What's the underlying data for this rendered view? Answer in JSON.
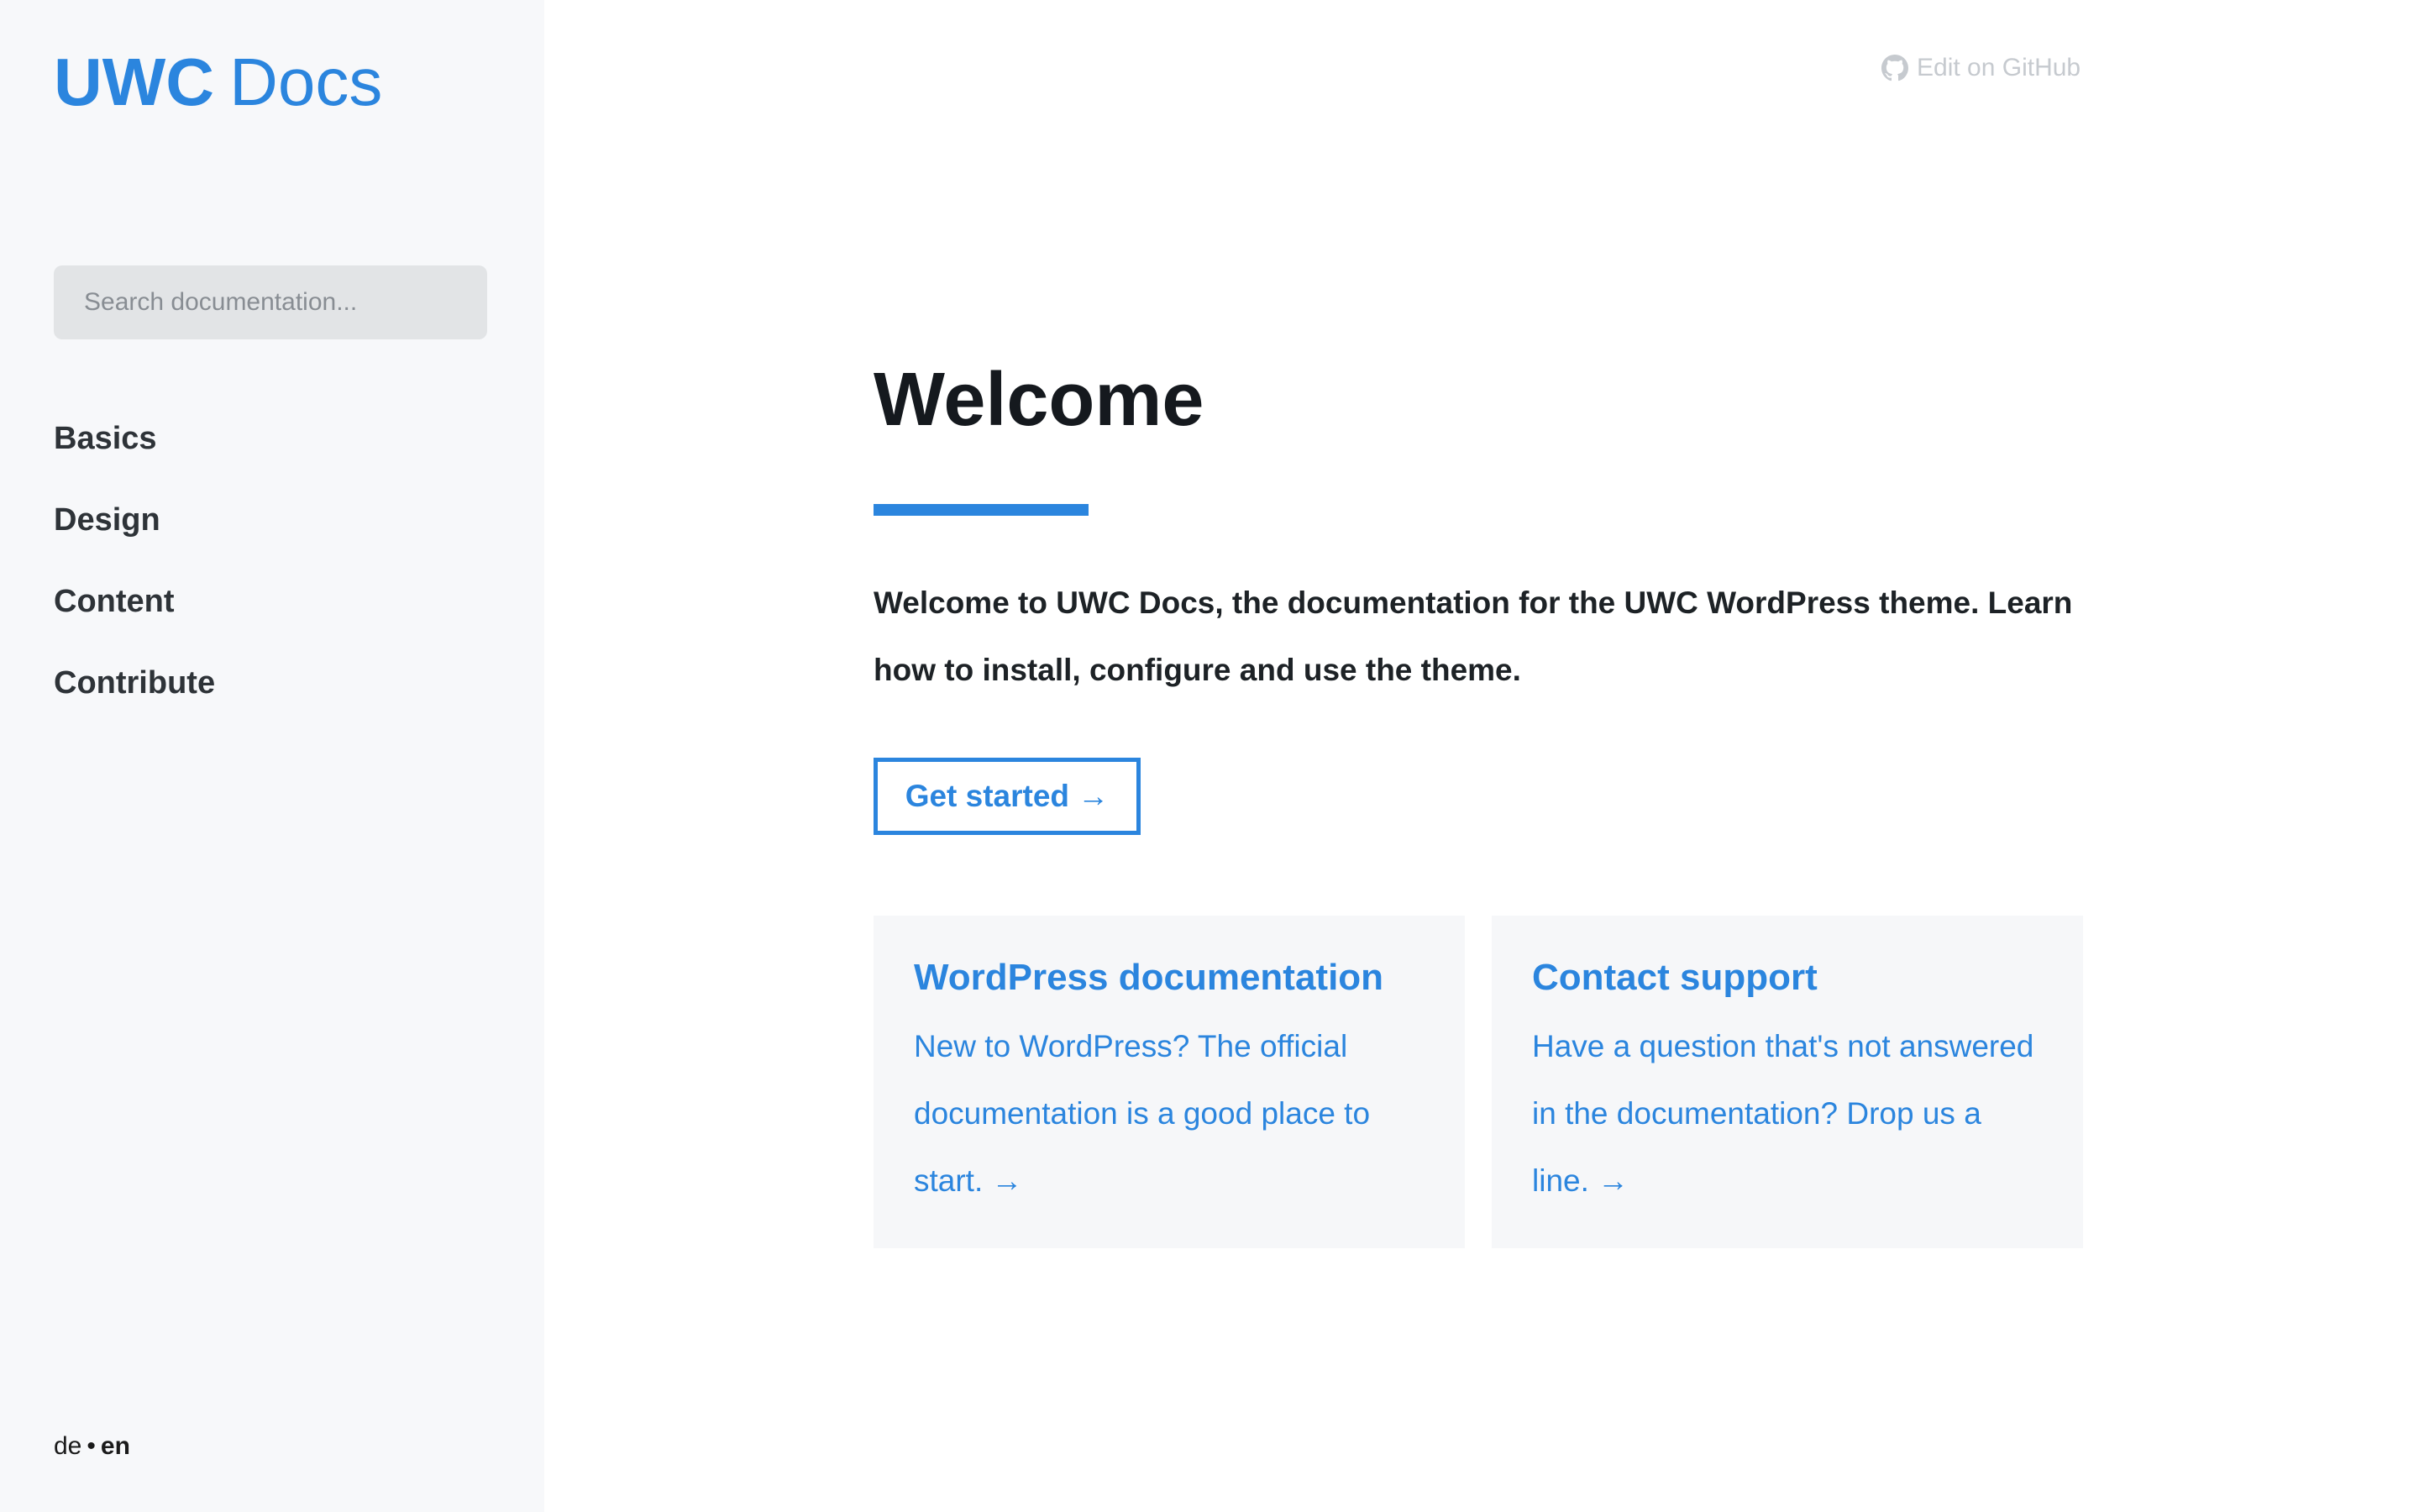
{
  "colors": {
    "accent": "#2b85de",
    "sidebar_bg": "#f7f8fa",
    "card_bg": "#f6f7f9",
    "text": "#15191e"
  },
  "sidebar": {
    "logo_bold": "UWC",
    "logo_light": "Docs",
    "search_placeholder": "Search documentation...",
    "nav": [
      "Basics",
      "Design",
      "Content",
      "Contribute"
    ],
    "languages": {
      "other": "de",
      "separator": "•",
      "current": "en"
    }
  },
  "header": {
    "edit_icon": "github-icon",
    "edit_label": "Edit on GitHub"
  },
  "main": {
    "title": "Welcome",
    "intro": "Welcome to UWC Docs, the documentation for the UWC WordPress theme. Learn how to install, configure and use the theme.",
    "cta_label": "Get started →",
    "cards": [
      {
        "title": "WordPress documentation",
        "text": "New to WordPress? The official documentation is a good place to start. →"
      },
      {
        "title": "Contact support",
        "text": "Have a question that's not answered in the documentation? Drop us a line. →"
      }
    ]
  }
}
